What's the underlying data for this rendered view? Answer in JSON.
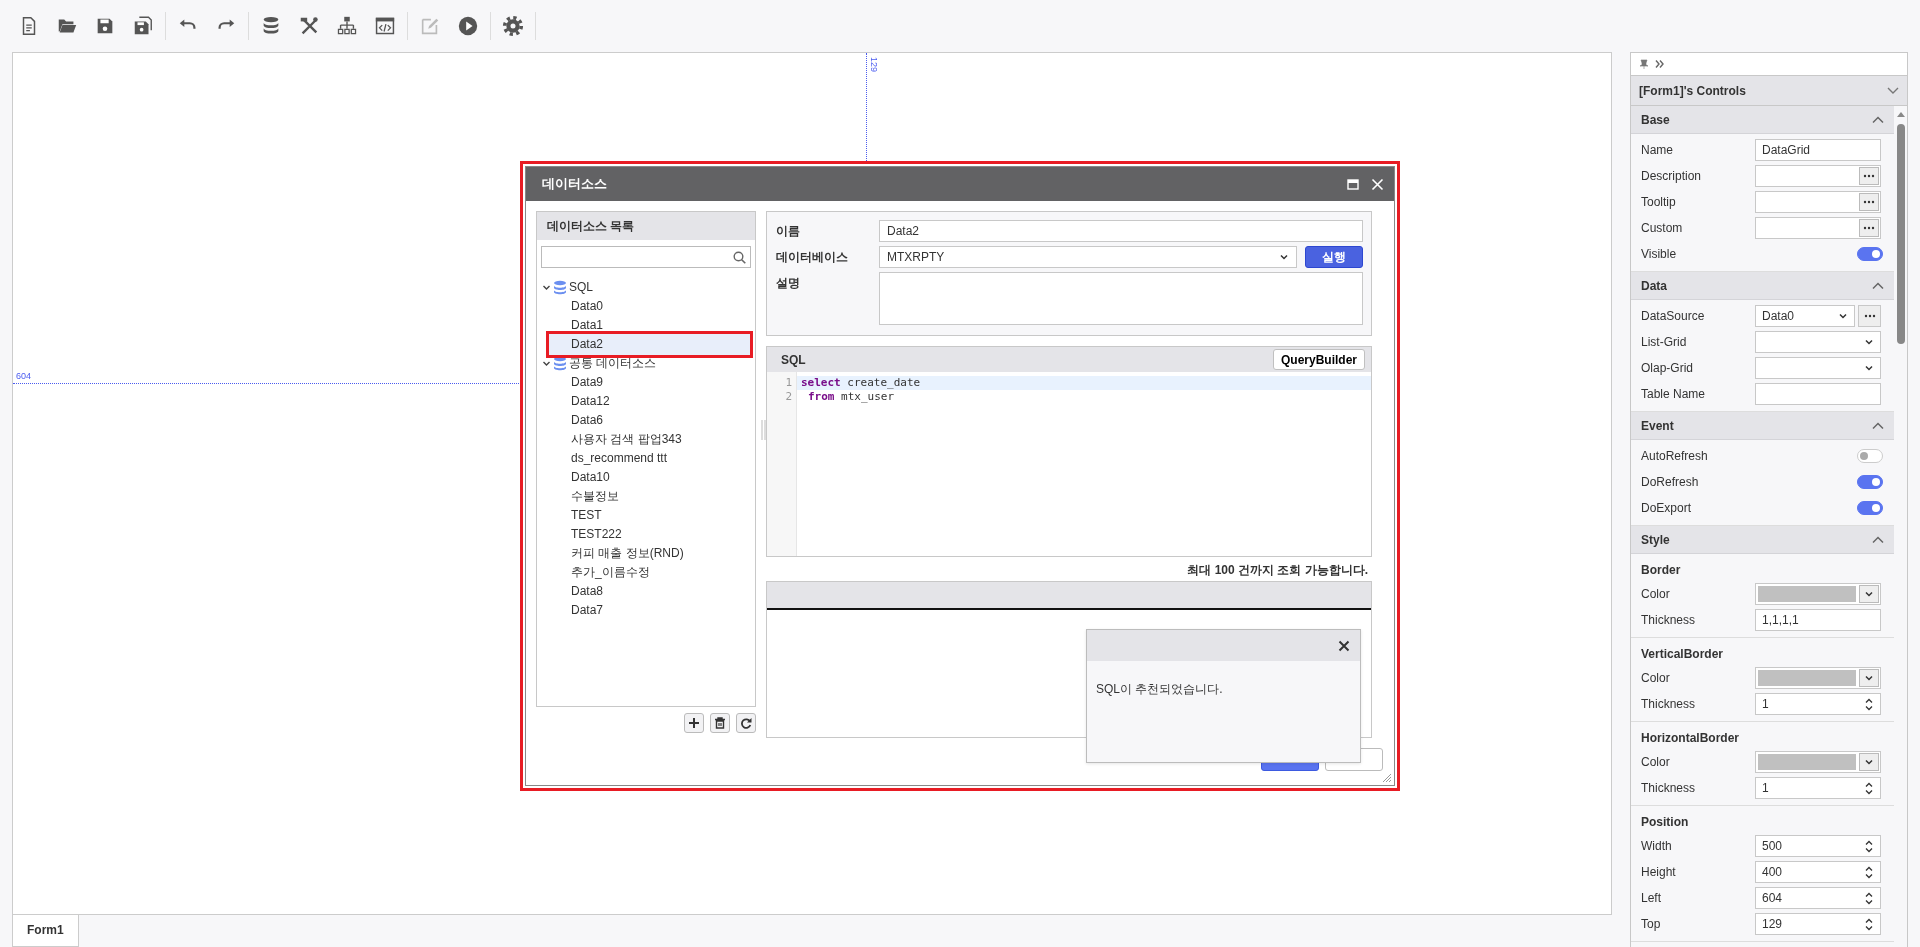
{
  "toolbar": [
    [
      {
        "kind": "new",
        "disabled": false
      },
      {
        "kind": "open",
        "disabled": false
      },
      {
        "kind": "save",
        "disabled": false
      },
      {
        "kind": "saveall",
        "disabled": false
      }
    ],
    [
      {
        "kind": "undo",
        "disabled": false
      },
      {
        "kind": "redo",
        "disabled": false
      }
    ],
    [
      {
        "kind": "database",
        "disabled": false
      },
      {
        "kind": "tools",
        "disabled": false
      },
      {
        "kind": "hierarchy",
        "disabled": false
      },
      {
        "kind": "code",
        "disabled": false
      }
    ],
    [
      {
        "kind": "edit",
        "disabled": true
      },
      {
        "kind": "run",
        "disabled": false
      }
    ],
    [
      {
        "kind": "settings",
        "disabled": false
      }
    ]
  ],
  "canvas": {
    "guides": [
      {
        "kind": "vertical",
        "label": "129"
      },
      {
        "kind": "horizontal",
        "label": "604"
      }
    ],
    "dialog": {
      "title": "데이터소스",
      "outlined": true,
      "list_panel": {
        "title": "데이터소스 목록",
        "tree": [
          {
            "label": "SQL",
            "expanded": true,
            "selected": false,
            "children": [
              {
                "label": "Data0",
                "selected": false
              },
              {
                "label": "Data1",
                "selected": false
              },
              {
                "label": "Data2",
                "selected": true
              }
            ]
          },
          {
            "label": "공통 데이터소스",
            "expanded": true,
            "selected": false,
            "children": [
              {
                "label": "Data9",
                "selected": false
              },
              {
                "label": "Data12",
                "selected": false
              },
              {
                "label": "Data6",
                "selected": false
              },
              {
                "label": "사용자 검색 팝업343",
                "selected": false
              },
              {
                "label": "ds_recommend ttt",
                "selected": false
              },
              {
                "label": "Data10",
                "selected": false
              },
              {
                "label": "수불정보",
                "selected": false
              },
              {
                "label": "TEST",
                "selected": false
              },
              {
                "label": "TEST222",
                "selected": false
              },
              {
                "label": "커피 매출 정보(RND)",
                "selected": false
              },
              {
                "label": "추가_이름수정",
                "selected": false
              },
              {
                "label": "Data8",
                "selected": false
              },
              {
                "label": "Data7",
                "selected": false
              }
            ]
          }
        ]
      },
      "fields": [
        {
          "label": "이름",
          "kind": "text",
          "value": "Data2"
        },
        {
          "label": "데이터베이스",
          "kind": "select",
          "value": "MTXRPTY",
          "button": "실행"
        },
        {
          "label": "설명",
          "kind": "textarea"
        }
      ],
      "sql": {
        "title": "SQL",
        "button": "QueryBuilder",
        "lines": [
          {
            "number": "1",
            "active": true,
            "indented": false,
            "tokens": [
              {
                "kind": "keyword",
                "text": "select"
              },
              {
                "kind": "plain",
                "text": " create_date"
              }
            ]
          },
          {
            "number": "2",
            "active": false,
            "indented": true,
            "tokens": [
              {
                "kind": "keyword",
                "text": "from"
              },
              {
                "kind": "plain",
                "text": " mtx_user"
              }
            ]
          }
        ]
      },
      "note": "최대 100 건까지 조회 가능합니다.",
      "toast": {
        "message": "SQL이 추천되었습니다."
      }
    }
  },
  "form_tabs": [
    {
      "label": "Form1",
      "selected": true
    }
  ],
  "properties": {
    "title": "[Form1]'s Controls",
    "sections": [
      {
        "title": "Base",
        "expanded": true,
        "groups": [
          {
            "rows": [
              {
                "label": "Name",
                "kind": "text",
                "value": "DataGrid"
              },
              {
                "label": "Description",
                "kind": "ellipsis"
              },
              {
                "label": "Tooltip",
                "kind": "ellipsis"
              },
              {
                "label": "Custom",
                "kind": "ellipsis"
              },
              {
                "label": "Visible",
                "kind": "toggle",
                "on": true
              }
            ]
          }
        ]
      },
      {
        "title": "Data",
        "expanded": true,
        "groups": [
          {
            "rows": [
              {
                "label": "DataSource",
                "kind": "select-ellipsis",
                "value": "Data0"
              },
              {
                "label": "List-Grid",
                "kind": "select"
              },
              {
                "label": "Olap-Grid",
                "kind": "select"
              },
              {
                "label": "Table Name",
                "kind": "text"
              }
            ]
          }
        ]
      },
      {
        "title": "Event",
        "expanded": true,
        "groups": [
          {
            "rows": [
              {
                "label": "AutoRefresh",
                "kind": "toggle",
                "on": false
              },
              {
                "label": "DoRefresh",
                "kind": "toggle",
                "on": true
              },
              {
                "label": "DoExport",
                "kind": "toggle",
                "on": true
              }
            ]
          }
        ]
      },
      {
        "title": "Style",
        "expanded": true,
        "groups": [
          {
            "title": "Border",
            "rows": [
              {
                "label": "Color",
                "kind": "color"
              },
              {
                "label": "Thickness",
                "kind": "text",
                "value": "1,1,1,1"
              }
            ]
          },
          {
            "title": "VerticalBorder",
            "rows": [
              {
                "label": "Color",
                "kind": "color"
              },
              {
                "label": "Thickness",
                "kind": "number",
                "value": "1"
              }
            ]
          },
          {
            "title": "HorizontalBorder",
            "rows": [
              {
                "label": "Color",
                "kind": "color"
              },
              {
                "label": "Thickness",
                "kind": "number",
                "value": "1"
              }
            ]
          },
          {
            "title": "Position",
            "rows": [
              {
                "label": "Width",
                "kind": "number",
                "value": "500"
              },
              {
                "label": "Height",
                "kind": "number",
                "value": "400"
              },
              {
                "label": "Left",
                "kind": "number",
                "value": "604"
              },
              {
                "label": "Top",
                "kind": "number",
                "value": "129"
              }
            ]
          }
        ]
      }
    ]
  }
}
